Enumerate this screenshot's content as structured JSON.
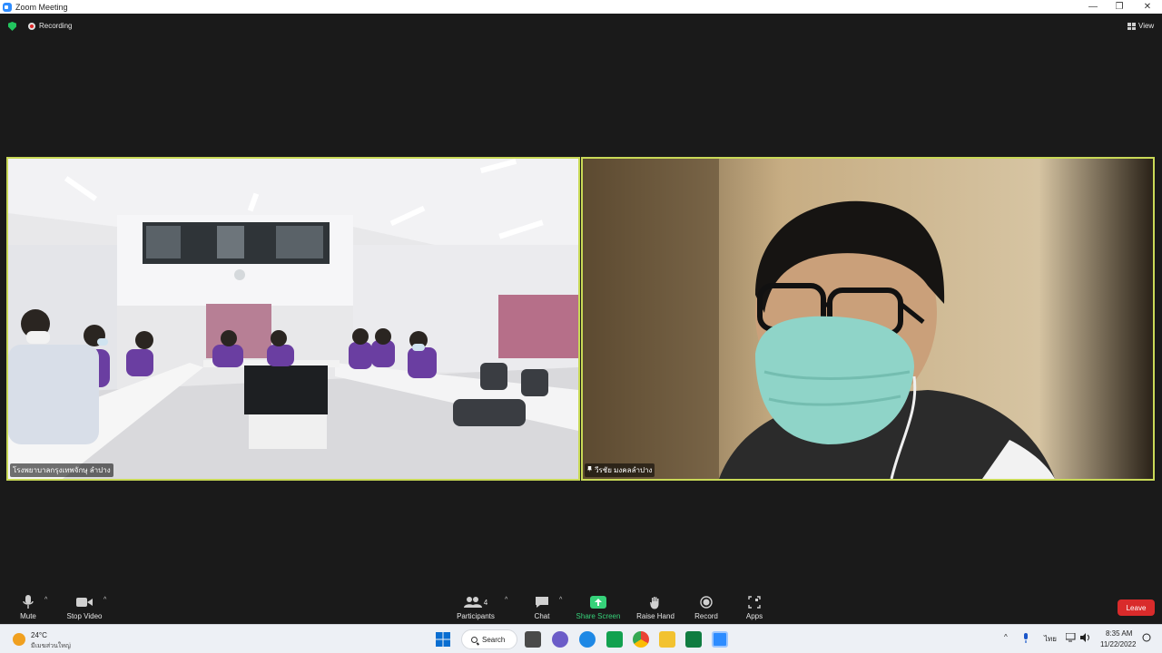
{
  "window": {
    "title": "Zoom Meeting",
    "controls": [
      "—",
      "❐",
      "✕"
    ]
  },
  "topbar": {
    "recording_label": "Recording",
    "view_label": "View"
  },
  "tiles": [
    {
      "name": "โรงพยาบาลกรุงเทพจักษุ ลำปาง"
    },
    {
      "name": "วีรชัย มงคลลำปาง"
    }
  ],
  "controls": {
    "mute": "Mute",
    "stop_video": "Stop Video",
    "participants": "Participants",
    "participants_count": "4",
    "chat": "Chat",
    "share_screen": "Share Screen",
    "raise_hand": "Raise Hand",
    "record": "Record",
    "apps": "Apps",
    "leave": "Leave",
    "caret": "^"
  },
  "taskbar": {
    "weather_temp": "24°C",
    "weather_condition": "มีเมฆส่วนใหญ่",
    "search_label": "Search",
    "tray_chevron": "^",
    "language": "ไทย",
    "time": "8:35 AM",
    "date": "11/22/2022"
  },
  "colors": {
    "active_speaker_border": "#c9d957",
    "leave_button": "#d92b2b",
    "share_screen": "#36d27a",
    "recording_dot": "#e02828"
  }
}
